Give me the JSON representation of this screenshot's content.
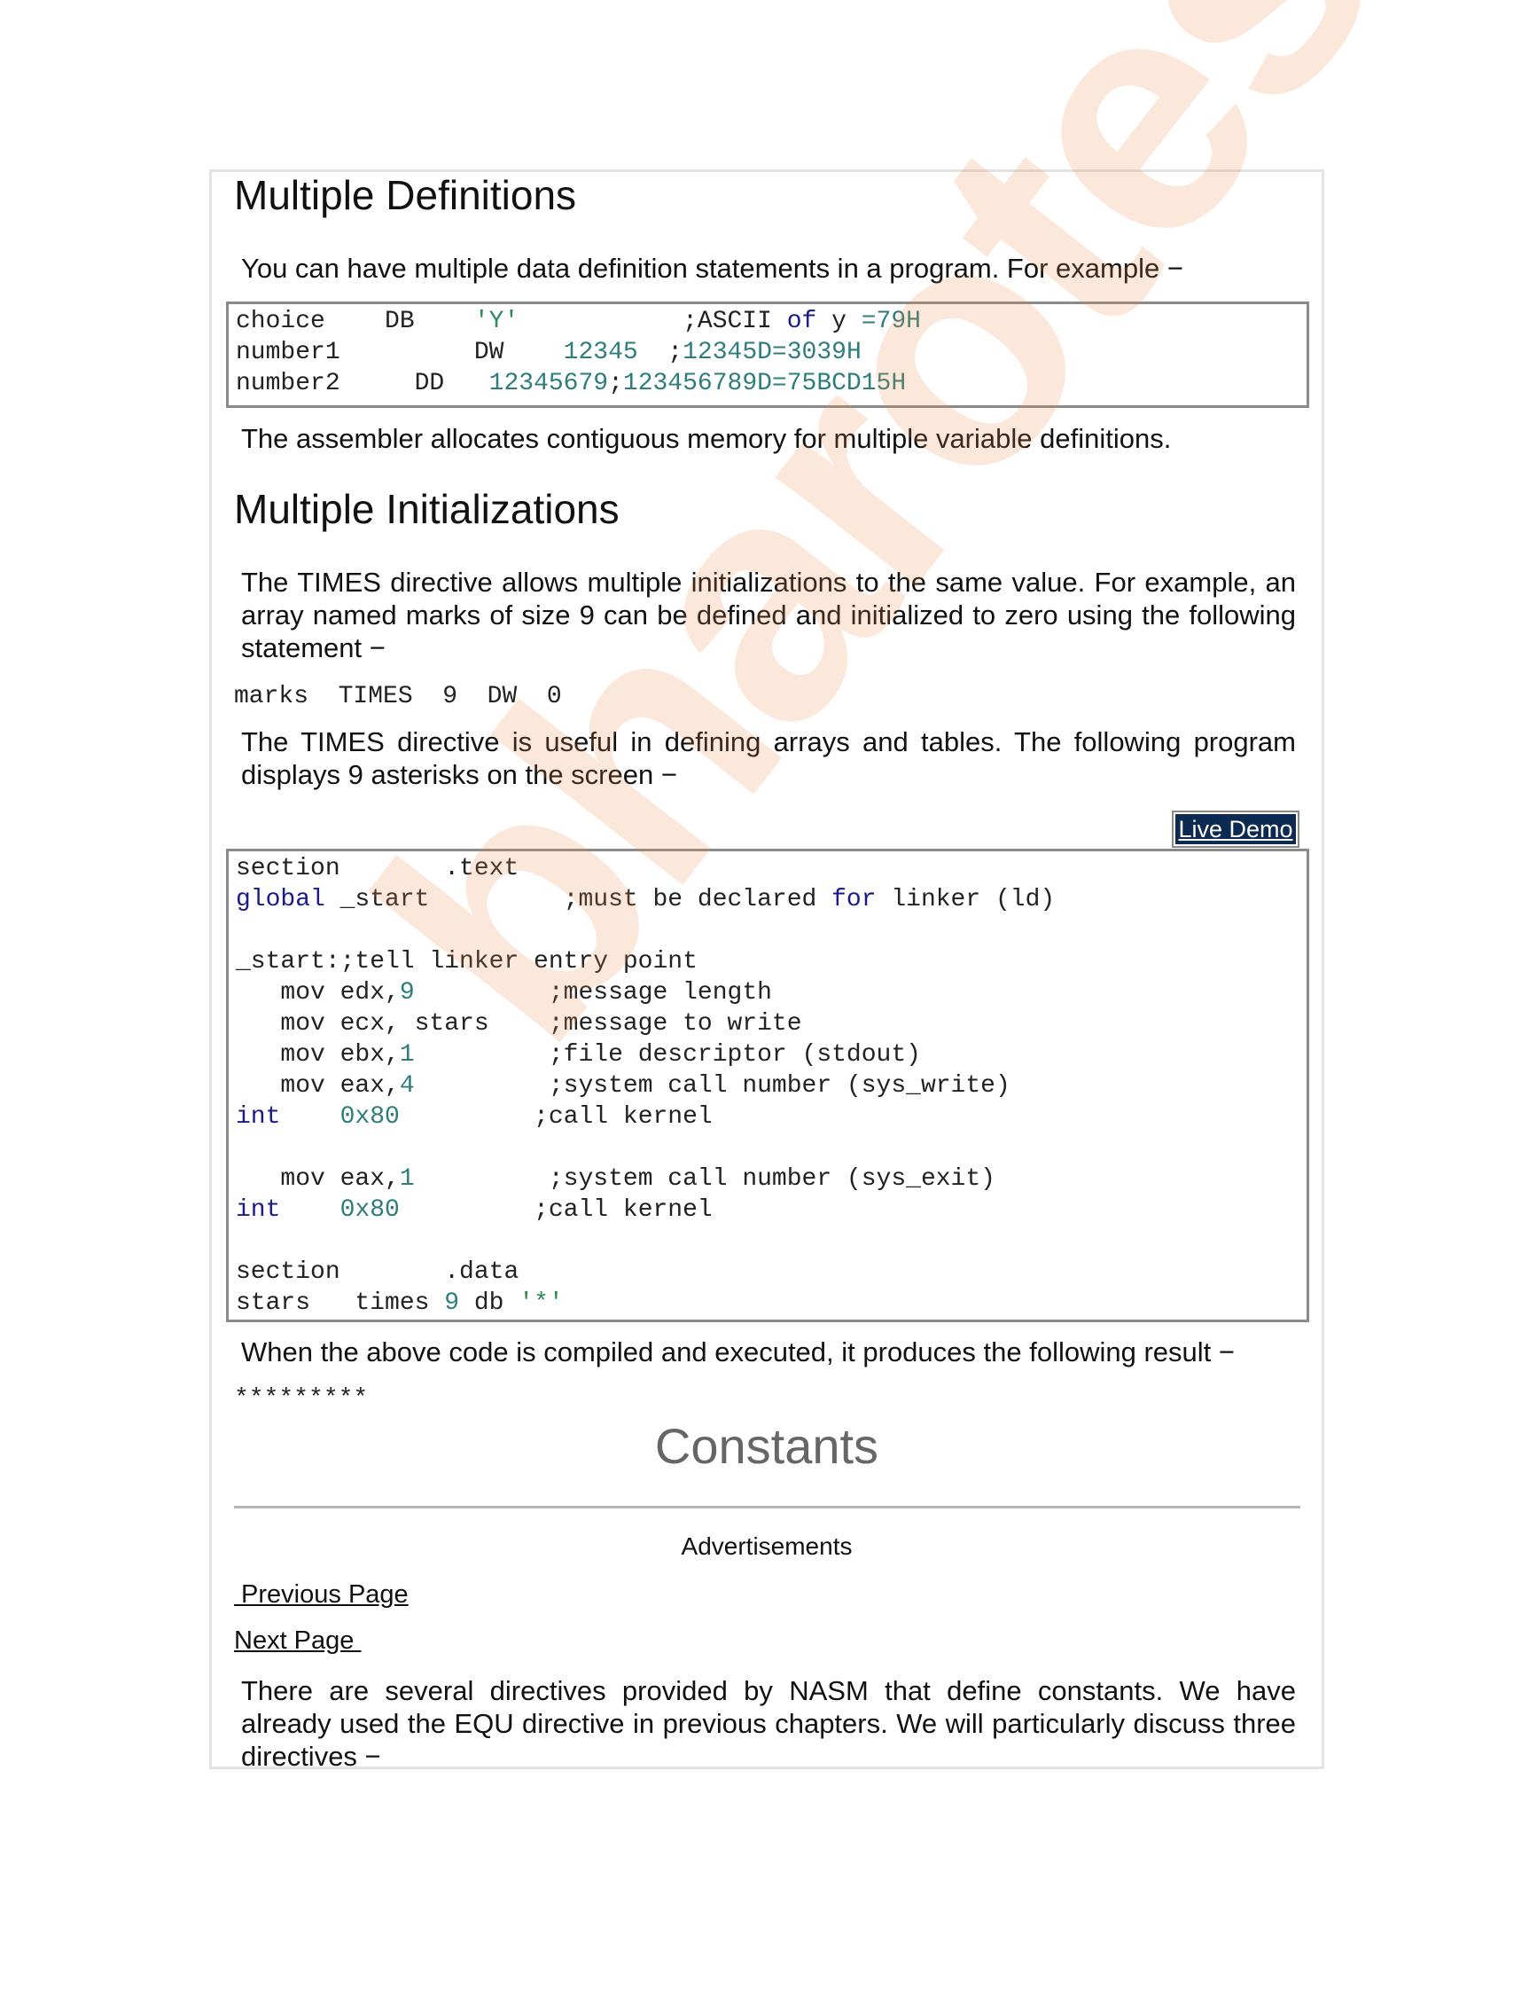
{
  "section1": {
    "heading": "Multiple Definitions",
    "intro": "You can have multiple data definition statements in a program. For example −",
    "after": "The assembler allocates contiguous memory for multiple variable definitions."
  },
  "section2": {
    "heading": "Multiple Initializations",
    "intro": "The TIMES directive allows multiple initializations to the same value. For example, an array named marks of size 9 can be defined and initialized to zero using the following statement −",
    "marks_stmt": "marks  TIMES  9  DW  0",
    "useful": "The TIMES directive is useful in defining arrays and tables. The following program displays 9 asterisks on the screen −",
    "live_demo": "Live Demo",
    "result_intro": "When the above code is compiled and executed, it produces the following result −",
    "result_output": "*********"
  },
  "section3": {
    "heading": "Constants",
    "ads": "Advertisements",
    "previous_page": " Previous Page",
    "next_page": "Next Page ",
    "intro": "There are several directives provided by NASM that define constants. We have already used the EQU directive in previous chapters. We will particularly discuss three directives −"
  },
  "watermark": "bharotes",
  "colors": {
    "keyword": "#1a1a8c",
    "number": "#2e7d7d",
    "string": "#2e8b57",
    "code_border": "#8a8a8a",
    "live_demo_bg": "#0d2a52"
  }
}
